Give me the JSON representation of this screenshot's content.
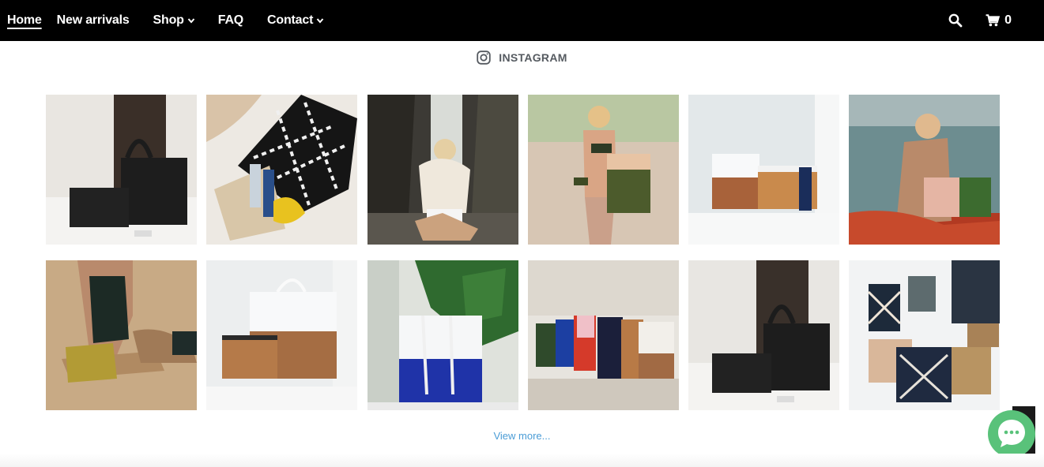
{
  "nav": {
    "items": [
      {
        "label": "Home",
        "active": true,
        "dropdown": false
      },
      {
        "label": "New arrivals",
        "active": false,
        "dropdown": false
      },
      {
        "label": "Shop",
        "active": false,
        "dropdown": true
      },
      {
        "label": "FAQ",
        "active": false,
        "dropdown": false
      },
      {
        "label": "Contact",
        "active": false,
        "dropdown": true
      }
    ],
    "cart_count": "0",
    "icons": {
      "search": "search-icon",
      "cart": "cart-icon"
    }
  },
  "instagram": {
    "heading": "INSTAGRAM",
    "view_more": "View more...",
    "posts": [
      {
        "alt": "black woven tote and pouch on white bed"
      },
      {
        "alt": "black and white woven bag with toiletries"
      },
      {
        "alt": "woman with bag by waterfall"
      },
      {
        "alt": "woman in bikini holding green tote on beach"
      },
      {
        "alt": "white and copper tote with pouch"
      },
      {
        "alt": "woman with pink and green tote by sea"
      },
      {
        "alt": "woman in black swimsuit with gold pouch on sand"
      },
      {
        "alt": "white and copper tote with copper pouch"
      },
      {
        "alt": "white and blue tote by plant"
      },
      {
        "alt": "row of colorful totes on stone wall"
      },
      {
        "alt": "black woven tote and pouch"
      },
      {
        "alt": "assorted woven bags on wall"
      }
    ]
  },
  "colors": {
    "topbar": "#000000",
    "link": "#4a9cd6",
    "chat": "#59c27a",
    "heading": "#555a60"
  }
}
